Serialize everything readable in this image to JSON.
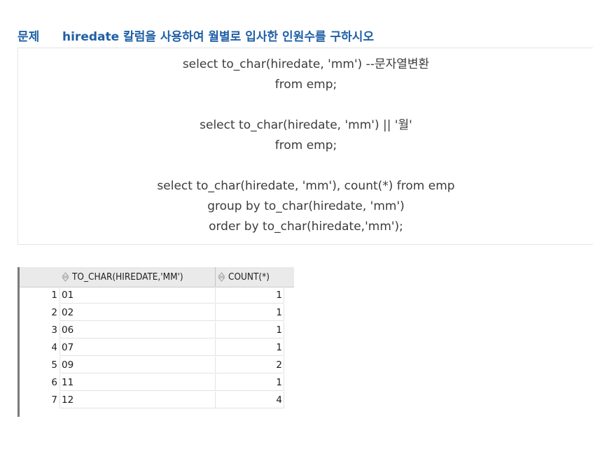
{
  "question": {
    "label": "문제",
    "text": "hiredate 칼럼을 사용하여 월별로 입사한 인원수를 구하시오"
  },
  "code_lines": [
    "select to_char(hiredate, 'mm') --문자열변환",
    "from emp;",
    "",
    "select to_char(hiredate, 'mm') || '월'",
    "from emp;",
    "",
    "select to_char(hiredate, 'mm'), count(*) from emp",
    "group by to_char(hiredate, 'mm')",
    "order by to_char(hiredate,'mm');"
  ],
  "result_grid": {
    "columns": [
      "TO_CHAR(HIREDATE,'MM')",
      "COUNT(*)"
    ],
    "rows": [
      {
        "num": "1",
        "month": "01",
        "count": "1"
      },
      {
        "num": "2",
        "month": "02",
        "count": "1"
      },
      {
        "num": "3",
        "month": "06",
        "count": "1"
      },
      {
        "num": "4",
        "month": "07",
        "count": "1"
      },
      {
        "num": "5",
        "month": "09",
        "count": "2"
      },
      {
        "num": "6",
        "month": "11",
        "count": "1"
      },
      {
        "num": "7",
        "month": "12",
        "count": "4"
      }
    ]
  },
  "colors": {
    "question_text": "#1f5fa6",
    "code_text": "#3c3c3c"
  }
}
